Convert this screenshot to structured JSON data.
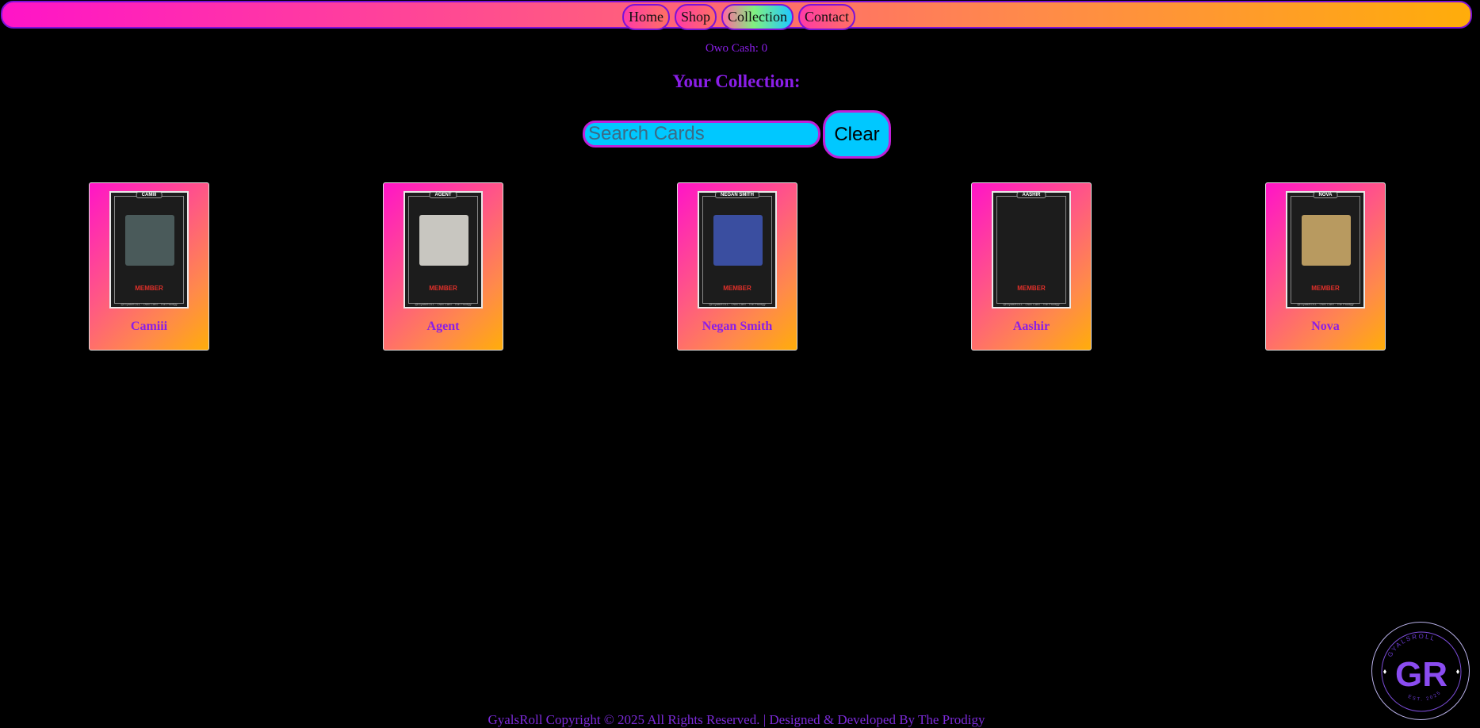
{
  "nav": {
    "items": [
      {
        "label": "Home",
        "active": false
      },
      {
        "label": "Shop",
        "active": false
      },
      {
        "label": "Collection",
        "active": true
      },
      {
        "label": "Contact",
        "active": false
      }
    ]
  },
  "wallet": {
    "cash_text": "Owo Cash: 0"
  },
  "collection": {
    "title": "Your Collection:"
  },
  "search": {
    "placeholder": "Search Cards",
    "value": "",
    "clear_label": "Clear"
  },
  "cards": [
    {
      "name": "Camiii",
      "art_title": "CAMIII",
      "art_badge": "MEMBER",
      "art_footer": "@GyalsROLL · Owo Card · The Prodigy",
      "photo_color": "#4a5a5a"
    },
    {
      "name": "Agent",
      "art_title": "AGENT",
      "art_badge": "MEMBER",
      "art_footer": "@GyalsROLL · Owo Card · The Prodigy",
      "photo_color": "#c8c6c0"
    },
    {
      "name": "Negan Smith",
      "art_title": "NEGAN SMITH",
      "art_badge": "MEMBER",
      "art_footer": "@GyalsROLL · Owo Card · The Prodigy",
      "photo_color": "#3a4ea0"
    },
    {
      "name": "Aashir",
      "art_title": "AASHIR",
      "art_badge": "MEMBER",
      "art_footer": "@GyalsROLL · Owo Card · The Prodigy",
      "photo_color": "#1c1c1c"
    },
    {
      "name": "Nova",
      "art_title": "NOVA",
      "art_badge": "MEMBER",
      "art_footer": "@GyalsROLL · Owo Card · The Prodigy",
      "photo_color": "#b89a60"
    }
  ],
  "logo": {
    "ring_text": "GYALSROLL",
    "monogram": "GR",
    "est_text": "EST. 2025",
    "icon": "sparkle-icon"
  },
  "footer": {
    "text": "GyalsRoll Copyright © 2025 All Rights Reserved. | Designed & Developed By The Prodigy"
  },
  "colors": {
    "accent": "#8a1ee8",
    "input_bg": "#00c8ff",
    "gradient_start": "#ff14c8",
    "gradient_end": "#ffad0a"
  }
}
